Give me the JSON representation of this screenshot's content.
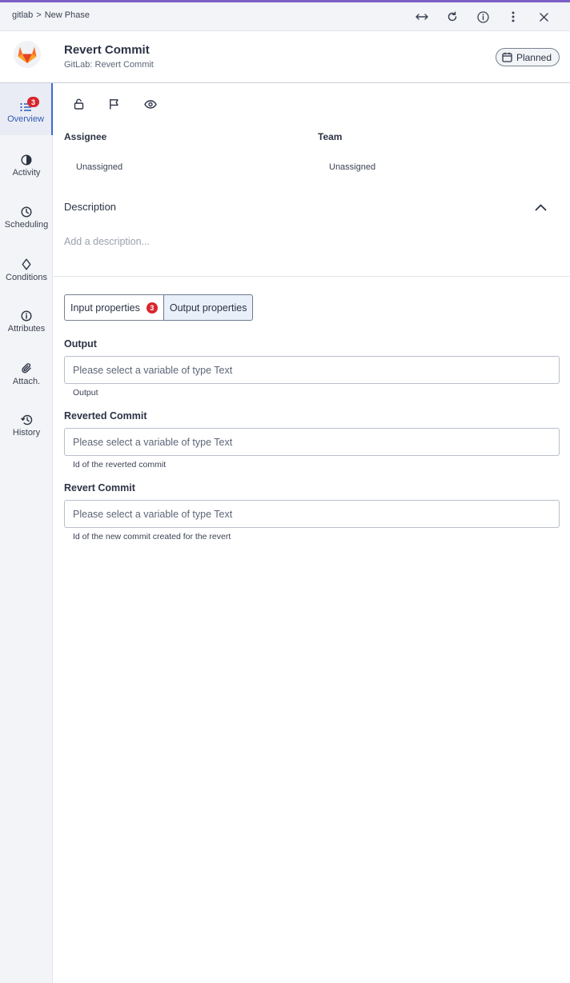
{
  "breadcrumb": {
    "root": "gitlab",
    "separator": ">",
    "current": "New Phase"
  },
  "header": {
    "title": "Revert Commit",
    "subtitle": "GitLab: Revert Commit",
    "status": "Planned"
  },
  "sidebar": {
    "items": [
      {
        "label": "Overview",
        "icon": "list-icon",
        "badge": "3",
        "active": true
      },
      {
        "label": "Activity",
        "icon": "pie-chart-icon"
      },
      {
        "label": "Scheduling",
        "icon": "clock-icon"
      },
      {
        "label": "Conditions",
        "icon": "diamond-icon"
      },
      {
        "label": "Attributes",
        "icon": "info-icon"
      },
      {
        "label": "Attach.",
        "icon": "paperclip-icon"
      },
      {
        "label": "History",
        "icon": "history-icon"
      }
    ]
  },
  "fields": {
    "assignee_label": "Assignee",
    "assignee_value": "Unassigned",
    "team_label": "Team",
    "team_value": "Unassigned"
  },
  "description": {
    "title": "Description",
    "placeholder": "Add a description..."
  },
  "tabs": {
    "input_label": "Input properties",
    "input_badge": "3",
    "output_label": "Output properties"
  },
  "properties": [
    {
      "label": "Output",
      "placeholder": "Please select a variable of type Text",
      "help": "Output"
    },
    {
      "label": "Reverted Commit",
      "placeholder": "Please select a variable of type Text",
      "help": "Id of the reverted commit"
    },
    {
      "label": "Revert Commit",
      "placeholder": "Please select a variable of type Text",
      "help": "Id of the new commit created for the revert"
    }
  ],
  "colors": {
    "accent": "#3d6bce",
    "badge": "#d9262e",
    "topline": "#7b5fc7",
    "gitlab_orange": "#e24329"
  }
}
